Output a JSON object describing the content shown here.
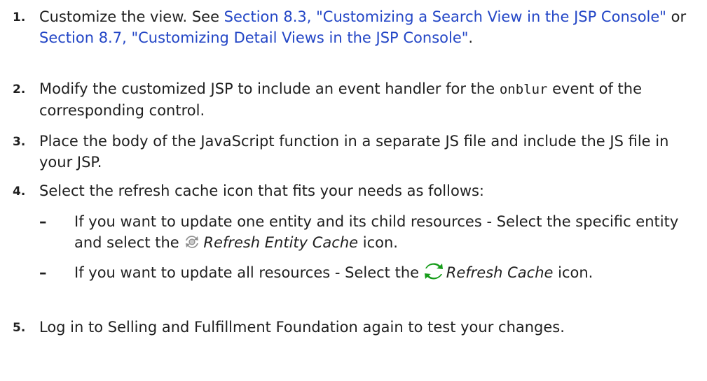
{
  "steps": [
    {
      "number": "1.",
      "text_before_links": "Customize the view. See ",
      "link1": "Section 8.3, \"Customizing a Search View in the JSP Console\"",
      "middle_text": " or ",
      "link2": "Section 8.7, \"Customizing Detail Views in the JSP Console\"",
      "end_text": "."
    },
    {
      "number": "2.",
      "text_before_code": "Modify the customized JSP to include an event handler for the ",
      "code": "onblur",
      "text_after_code": " event of the corresponding control."
    },
    {
      "number": "3.",
      "text": "Place the body of the JavaScript function in a separate JS file and include the JS file in your JSP."
    },
    {
      "number": "4.",
      "text": "Select the refresh cache icon that fits your needs as follows:",
      "bullets": [
        {
          "dash": "–",
          "text_before_icon": "If you want to update one entity and its child resources - Select the specific entity and select the ",
          "icon_name": "refresh-entity-cache-icon",
          "italic": "Refresh Entity Cache",
          "text_after_italic": " icon."
        },
        {
          "dash": "–",
          "text_before_icon": "If you want to update all resources - Select the ",
          "icon_name": "refresh-cache-icon",
          "italic": "Refresh Cache",
          "text_after_italic": " icon."
        }
      ]
    },
    {
      "number": "5.",
      "text": "Log in to Selling and Fulfillment Foundation again to test your changes."
    }
  ],
  "colors": {
    "text": "#1f1f1f",
    "link": "#2346c6",
    "entity_icon": "#8f8f8f",
    "cache_icon_green": "#159c19"
  }
}
